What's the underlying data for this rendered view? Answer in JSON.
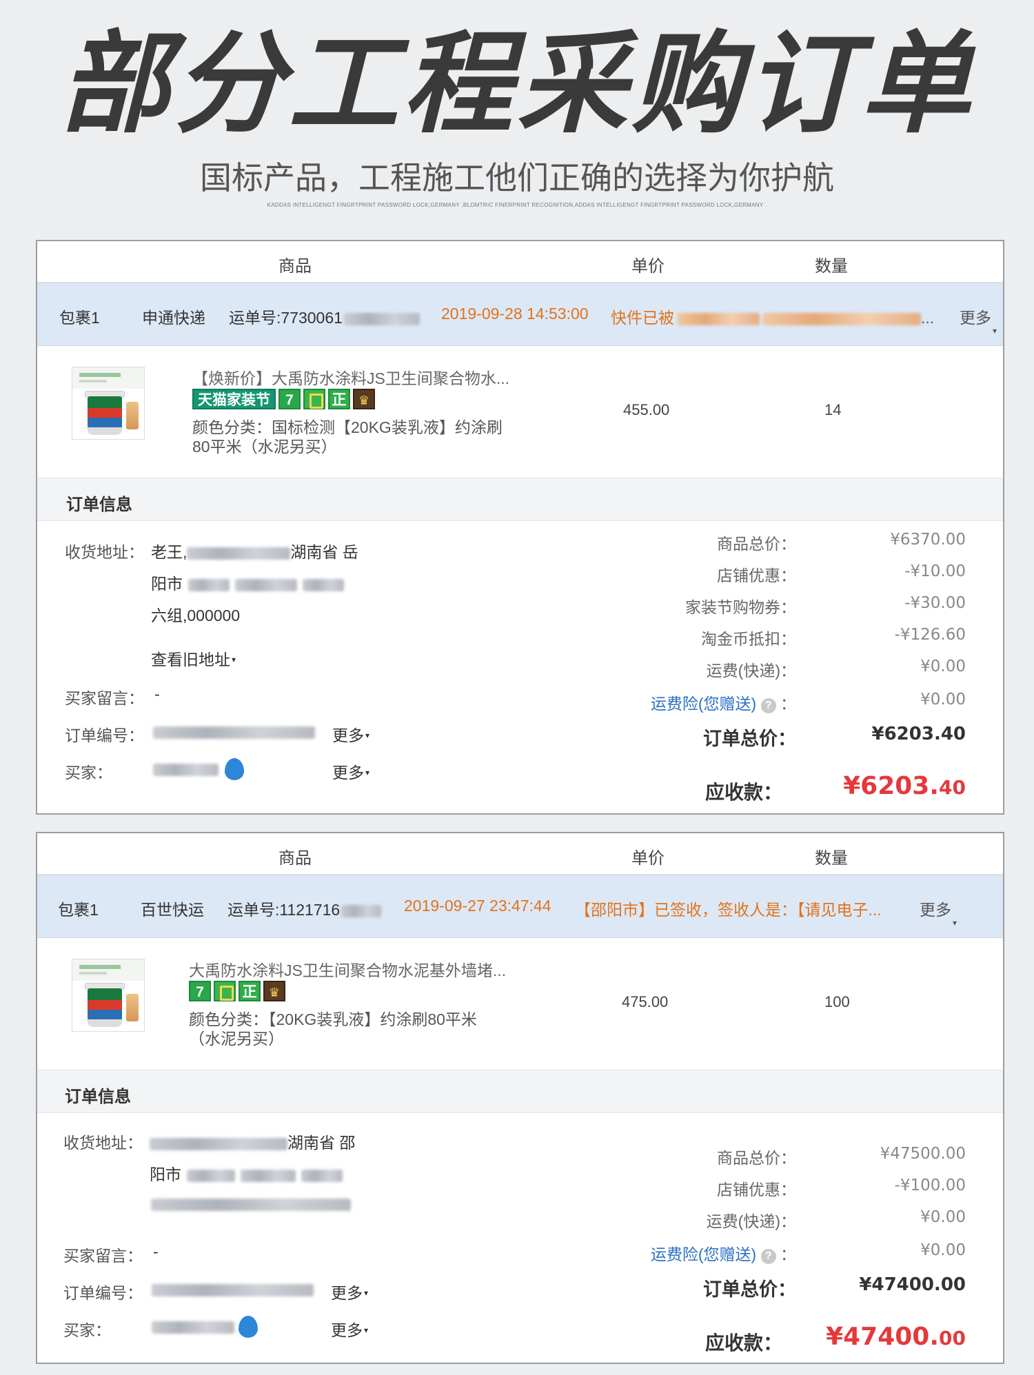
{
  "hero": {
    "title": "部分工程采购订单",
    "subtitle": "国标产品，工程施工他们正确的选择为你护航",
    "fineprint": "KADDAS INTELLIGENGT FINGRTPRINT PASSWORD LOCK,GERMANY ,BLOMTRIC FINERPRINT RECOGNITION,ADDAS INTELLIGENGT FINGRTPRINT PASSWORD LOCK,GERMANY ."
  },
  "columns": {
    "goods": "商品",
    "price": "单价",
    "qty": "数量"
  },
  "labels": {
    "order_info": "订单信息",
    "address": "收货地址：",
    "view_old_address": "查看旧地址",
    "buyer_message": "买家留言：",
    "order_no": "订单编号：",
    "buyer": "买家：",
    "more": "更多",
    "goods_total": "商品总价：",
    "shop_discount": "店铺优惠：",
    "home_coupon": "家装节购物券：",
    "taojinbi": "淘金币抵扣：",
    "shipping": "运费(快递)：",
    "shipping_insurance": "运费险(您赠送)",
    "colon": "：",
    "order_total": "订单总价：",
    "amount_due": "应收款："
  },
  "orders": [
    {
      "package": {
        "name": "包裹1",
        "carrier": "申通快递",
        "tracking": "运单号:7730061",
        "time": "2019-09-28 14:53:00",
        "status": "快件已被",
        "ellipsis": "...",
        "more": "更多"
      },
      "product": {
        "title": "【焕新价】大禹防水涂料JS卫生间聚合物水...",
        "badge_text": "天猫家装节",
        "badge_seven": "7",
        "badge_zheng": "正",
        "badge_crown": "♛",
        "spec_line1": "颜色分类：国标检测【20KG装乳液】约涂刷",
        "spec_line2": "80平米（水泥另买）",
        "price": "455.00",
        "qty": "14"
      },
      "address": {
        "line1_name": "老王,",
        "line1_region": "湖南省 岳",
        "line2_city": "阳市",
        "line3": "六组,000000"
      },
      "buyer_message": "-",
      "summary": {
        "goods_total": "¥6370.00",
        "shop_discount": "-¥10.00",
        "home_coupon": "-¥30.00",
        "taojinbi": "-¥126.60",
        "shipping": "¥0.00",
        "shipping_insurance": "¥0.00",
        "order_total": "¥6203.40",
        "amount_due_main": "¥6203.",
        "amount_due_cents": "40"
      }
    },
    {
      "package": {
        "name": "包裹1",
        "carrier": "百世快运",
        "tracking": "运单号:1121716",
        "time": "2019-09-27 23:47:44",
        "status": "【邵阳市】已签收，签收人是：【请见电子...",
        "more": "更多"
      },
      "product": {
        "title": "大禹防水涂料JS卫生间聚合物水泥基外墙堵...",
        "badge_seven": "7",
        "badge_zheng": "正",
        "badge_crown": "♛",
        "spec_line1": "颜色分类：【20KG装乳液】约涂刷80平米",
        "spec_line2": "（水泥另买）",
        "price": "475.00",
        "qty": "100"
      },
      "address": {
        "line1_region": "湖南省 邵",
        "line2_city": "阳市"
      },
      "buyer_message": "-",
      "summary": {
        "goods_total": "¥47500.00",
        "shop_discount": "-¥100.00",
        "shipping": "¥0.00",
        "shipping_insurance": "¥0.00",
        "order_total": "¥47400.00",
        "amount_due_main": "¥47400.",
        "amount_due_cents": "00"
      }
    }
  ]
}
